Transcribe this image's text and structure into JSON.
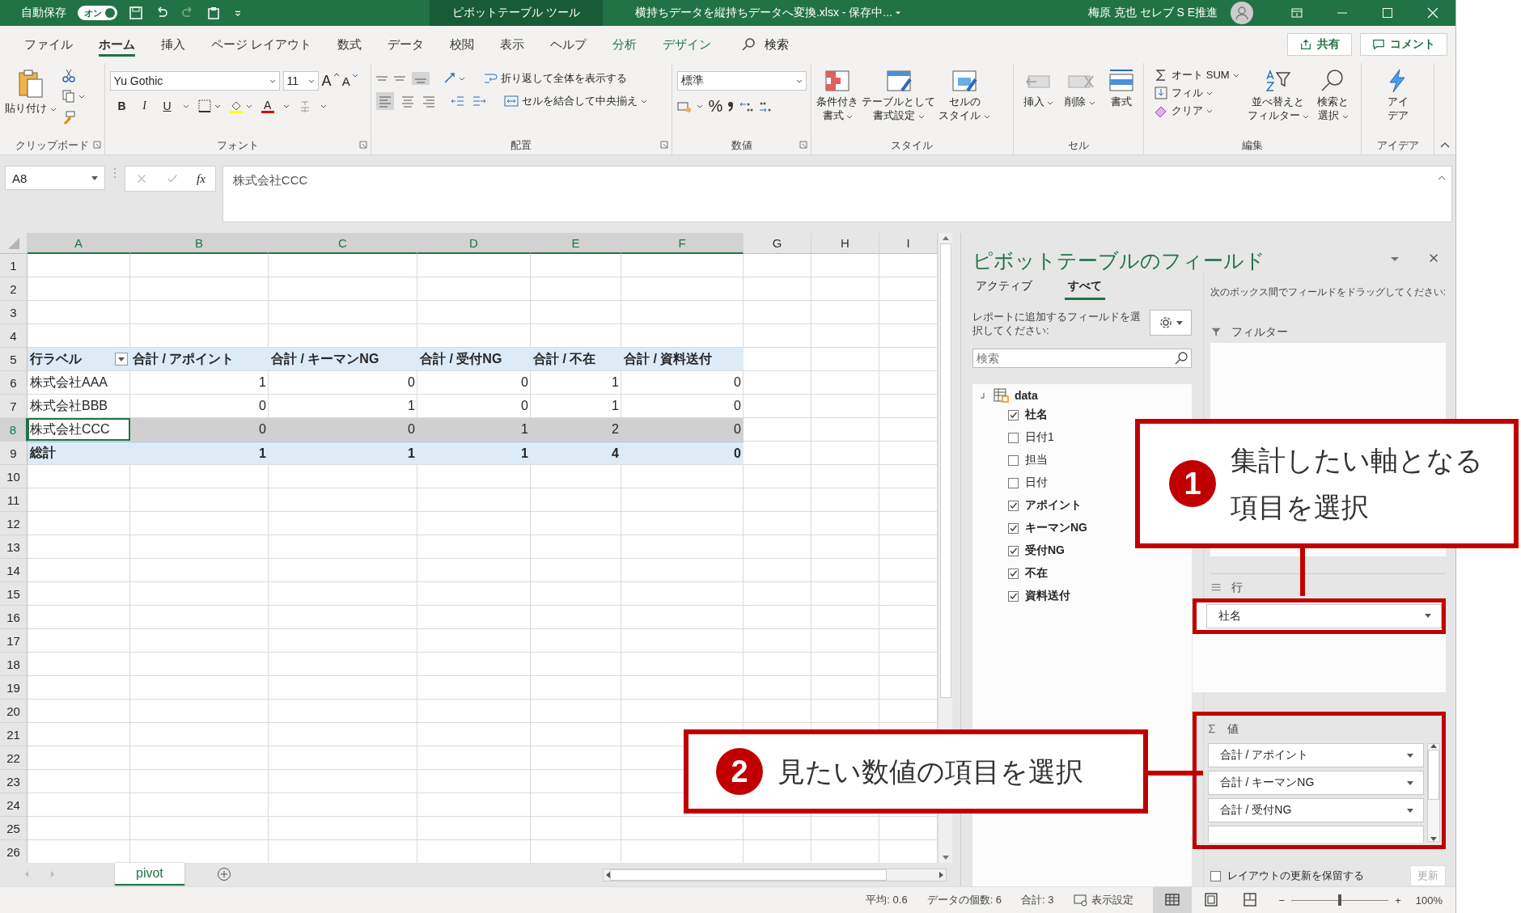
{
  "title_bar": {
    "autosave_label": "自動保存",
    "autosave_toggle": "オン",
    "autosave_on": true,
    "context_tab": "ピボットテーブル ツール",
    "document_title": "横持ちデータを縦持ちデータへ変換.xlsx - 保存中...",
    "user": "梅原 克也 セレブ S E推進"
  },
  "menu_tabs": [
    {
      "label": "ファイル",
      "selected": false,
      "kind": "normal"
    },
    {
      "label": "ホーム",
      "selected": true,
      "kind": "normal"
    },
    {
      "label": "挿入",
      "selected": false,
      "kind": "normal"
    },
    {
      "label": "ページ レイアウト",
      "selected": false,
      "kind": "normal"
    },
    {
      "label": "数式",
      "selected": false,
      "kind": "normal"
    },
    {
      "label": "データ",
      "selected": false,
      "kind": "normal"
    },
    {
      "label": "校閲",
      "selected": false,
      "kind": "normal"
    },
    {
      "label": "表示",
      "selected": false,
      "kind": "normal"
    },
    {
      "label": "ヘルプ",
      "selected": false,
      "kind": "normal"
    },
    {
      "label": "分析",
      "selected": false,
      "kind": "contextual"
    },
    {
      "label": "デザイン",
      "selected": false,
      "kind": "contextual"
    }
  ],
  "search": {
    "label": "検索"
  },
  "share_button": "共有",
  "comment_button": "コメント",
  "ribbon": {
    "clipboard": {
      "label": "クリップボード",
      "paste": "貼り付け"
    },
    "font": {
      "label": "フォント",
      "family": "Yu Gothic",
      "size": "11",
      "grow": "A",
      "shrink": "A",
      "styles": [
        "B",
        "I",
        "U"
      ],
      "color_letter": "A"
    },
    "alignment": {
      "label": "配置",
      "wrap": "折り返して全体を表示する",
      "merge": "セルを結合して中央揃え"
    },
    "number": {
      "label": "数値",
      "format": "標準",
      "percent": "%"
    },
    "styles": {
      "label": "スタイル",
      "buttons": [
        {
          "lines": [
            "条件付き",
            "書式"
          ]
        },
        {
          "lines": [
            "テーブルとして",
            "書式設定"
          ]
        },
        {
          "lines": [
            "セルの",
            "スタイル"
          ]
        }
      ]
    },
    "cells": {
      "label": "セル",
      "buttons": [
        "挿入",
        "削除",
        "書式"
      ]
    },
    "editing": {
      "label": "編集",
      "autosum": "オート SUM",
      "fill": "フィル",
      "clear": "クリア",
      "sort": [
        "並べ替えと",
        "フィルター"
      ],
      "find": [
        "検索と",
        "選択"
      ]
    },
    "ideas": {
      "label": "アイデア",
      "button": [
        "アイ",
        "デア"
      ]
    }
  },
  "formula_bar": {
    "name_box": "A8",
    "fx": "fx",
    "formula": "株式会社CCC"
  },
  "sheet": {
    "columns": [
      {
        "label": "A",
        "selected": true
      },
      {
        "label": "B",
        "selected": true
      },
      {
        "label": "C",
        "selected": true
      },
      {
        "label": "D",
        "selected": true
      },
      {
        "label": "E",
        "selected": true
      },
      {
        "label": "F",
        "selected": true
      },
      {
        "label": "G",
        "selected": false
      },
      {
        "label": "H",
        "selected": false
      },
      {
        "label": "I",
        "selected": false
      }
    ],
    "rows": [
      {
        "label": "1",
        "kind": "empty",
        "selected": false
      },
      {
        "label": "2",
        "kind": "empty",
        "selected": false
      },
      {
        "label": "3",
        "kind": "empty",
        "selected": false
      },
      {
        "label": "4",
        "kind": "empty",
        "selected": false
      },
      {
        "label": "5",
        "kind": "pivot_header",
        "selected": false,
        "cells": [
          "行ラベル",
          "合計 / アポイント",
          "合計 / キーマンNG",
          "合計 / 受付NG",
          "合計 / 不在",
          "合計 / 資料送付"
        ]
      },
      {
        "label": "6",
        "kind": "pivot_row",
        "selected": false,
        "cells": [
          "株式会社AAA",
          "1",
          "0",
          "0",
          "1",
          "0"
        ]
      },
      {
        "label": "7",
        "kind": "pivot_row",
        "selected": false,
        "cells": [
          "株式会社BBB",
          "0",
          "1",
          "0",
          "1",
          "0"
        ]
      },
      {
        "label": "8",
        "kind": "pivot_row",
        "selected": true,
        "cells": [
          "株式会社CCC",
          "0",
          "0",
          "1",
          "2",
          "0"
        ]
      },
      {
        "label": "9",
        "kind": "pivot_total",
        "selected": false,
        "cells": [
          "総計",
          "1",
          "1",
          "1",
          "4",
          "0"
        ]
      },
      {
        "label": "10",
        "kind": "empty",
        "selected": false
      },
      {
        "label": "11",
        "kind": "empty",
        "selected": false
      },
      {
        "label": "12",
        "kind": "empty",
        "selected": false
      },
      {
        "label": "13",
        "kind": "empty",
        "selected": false
      },
      {
        "label": "14",
        "kind": "empty",
        "selected": false
      },
      {
        "label": "15",
        "kind": "empty",
        "selected": false
      },
      {
        "label": "16",
        "kind": "empty",
        "selected": false
      },
      {
        "label": "17",
        "kind": "empty",
        "selected": false
      },
      {
        "label": "18",
        "kind": "empty",
        "selected": false
      },
      {
        "label": "19",
        "kind": "empty",
        "selected": false
      },
      {
        "label": "20",
        "kind": "empty",
        "selected": false
      },
      {
        "label": "21",
        "kind": "empty",
        "selected": false
      },
      {
        "label": "22",
        "kind": "empty",
        "selected": false
      },
      {
        "label": "23",
        "kind": "empty",
        "selected": false
      },
      {
        "label": "24",
        "kind": "empty",
        "selected": false
      },
      {
        "label": "25",
        "kind": "empty",
        "selected": false
      },
      {
        "label": "26",
        "kind": "empty",
        "selected": false
      }
    ]
  },
  "sheet_tabs": [
    {
      "label": "pivot",
      "selected": true
    }
  ],
  "pivot_pane": {
    "title": "ピボットテーブルのフィールド",
    "tabs": [
      {
        "label": "アクティブ",
        "selected": false
      },
      {
        "label": "すべて",
        "selected": true
      }
    ],
    "instruction": "レポートに追加するフィールドを選択してください:",
    "search_placeholder": "検索",
    "table": {
      "label": "data",
      "expanded": true,
      "children": [
        {
          "label": "社名",
          "checked": true
        },
        {
          "label": "日付1",
          "checked": false
        },
        {
          "label": "担当",
          "checked": false
        },
        {
          "label": "日付",
          "checked": false
        },
        {
          "label": "アポイント",
          "checked": true
        },
        {
          "label": "キーマンNG",
          "checked": true
        },
        {
          "label": "受付NG",
          "checked": true
        },
        {
          "label": "不在",
          "checked": true
        },
        {
          "label": "資料送付",
          "checked": true
        }
      ]
    },
    "drag_instruction": "次のボックス間でフィールドをドラッグしてください:",
    "filter_area": {
      "label": "フィルター"
    },
    "rows_area": {
      "label": "行",
      "items": [
        "社名"
      ]
    },
    "values_area": {
      "label": "値",
      "items": [
        "合計 / アポイント",
        "合計 / キーマンNG",
        "合計 / 受付NG"
      ]
    },
    "defer_update": {
      "label": "レイアウトの更新を保留する",
      "checked": false
    },
    "update_button": {
      "label": "更新",
      "disabled": true
    }
  },
  "status_bar": {
    "average": "平均: 0.6",
    "count": "データの個数: 6",
    "sum": "合計: 3",
    "display_settings": "表示設定",
    "views": [
      {
        "kind": "normal",
        "selected": true
      },
      {
        "kind": "page_layout",
        "selected": false
      },
      {
        "kind": "page_break",
        "selected": false
      }
    ],
    "zoom_minus": "−",
    "zoom_plus": "+",
    "zoom": {
      "level": 0.5
    },
    "zoom_text": "100%"
  },
  "callouts": [
    {
      "kind": "rows",
      "number": "1",
      "lines": [
        "集計したい軸となる",
        "項目を選択"
      ]
    },
    {
      "kind": "values",
      "number": "2",
      "lines": [
        "見たい数値の項目を選択"
      ]
    }
  ]
}
